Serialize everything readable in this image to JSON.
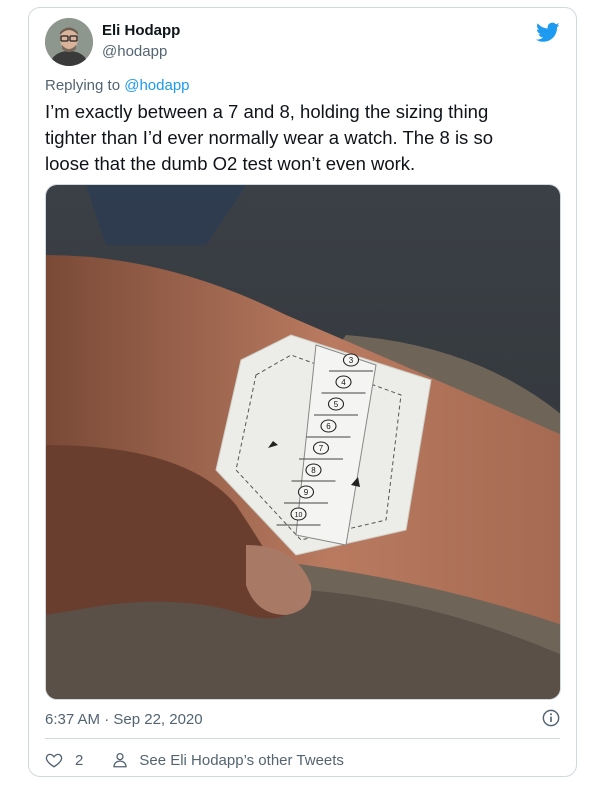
{
  "author": {
    "name": "Eli Hodapp",
    "handle": "@hodapp"
  },
  "reply": {
    "prefix": "Replying to ",
    "to": "@hodapp"
  },
  "tweet": {
    "lines": [
      "I’m exactly between a 7 and 8, holding the sizing thing",
      "tighter than I’d ever normally wear a watch. The 8 is so",
      "loose that the dumb O2 test won’t even work."
    ]
  },
  "media": {
    "band_numbers": [
      "3",
      "4",
      "5",
      "6",
      "7",
      "8",
      "9",
      "10"
    ]
  },
  "meta": {
    "timestamp": "6:37 AM · Sep 22, 2020"
  },
  "actions": {
    "like_count": "2",
    "see_more": "See Eli Hodapp’s other Tweets"
  },
  "icons": {
    "brand": "twitter-bird-icon",
    "like": "heart-icon",
    "profile": "person-icon",
    "info": "info-icon"
  },
  "colors": {
    "accent": "#1d9bf0",
    "text": "#0f1419",
    "muted": "#536471",
    "border": "#cfd9de"
  }
}
